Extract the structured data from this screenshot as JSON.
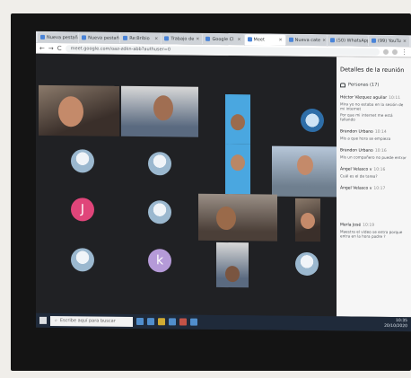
{
  "browser": {
    "tabs": [
      {
        "label": "Nueva pestaña"
      },
      {
        "label": "Nueva pestaña"
      },
      {
        "label": "Re:Bribio"
      },
      {
        "label": "Trabajo de"
      },
      {
        "label": "Google Cl"
      },
      {
        "label": "Meet"
      },
      {
        "label": "Nueva cate"
      },
      {
        "label": "(50) WhatsApp"
      },
      {
        "label": "(99) YouTu"
      }
    ],
    "url": "meet.google.com/oaz-zdkn-abb?authuser=0"
  },
  "meeting": {
    "avatar_letters": {
      "j": "J",
      "k": "k"
    }
  },
  "panel": {
    "title": "Detalles de la reunión",
    "people_label": "Personas (17)",
    "messages": [
      {
        "author": "Héctor Vázquez aguilar",
        "time": "10:11",
        "text": "Mira yo no estaba en la sesión de mi internet"
      },
      {
        "author": "",
        "time": "",
        "text": "Por que mi internet me está fallando"
      },
      {
        "author": "Brandon Urbano",
        "time": "10:14",
        "text": "Mis a que hora se empieza"
      },
      {
        "author": "Brandon Urbano",
        "time": "10:16",
        "text": "Mis un compañero no puede entrar"
      },
      {
        "author": "Ángel Velasco v",
        "time": "10:16",
        "text": "Cuál es el de tarea?"
      },
      {
        "author": "Ángel Velasco v",
        "time": "10:17",
        "text": ""
      },
      {
        "author": "María José",
        "time": "10:19",
        "text": "Maestra el video se entra porque entra en la hora padre ?"
      }
    ]
  },
  "taskbar": {
    "search_placeholder": "Escribe aquí para buscar",
    "clock_time": "10:35",
    "clock_date": "20/10/2020"
  }
}
